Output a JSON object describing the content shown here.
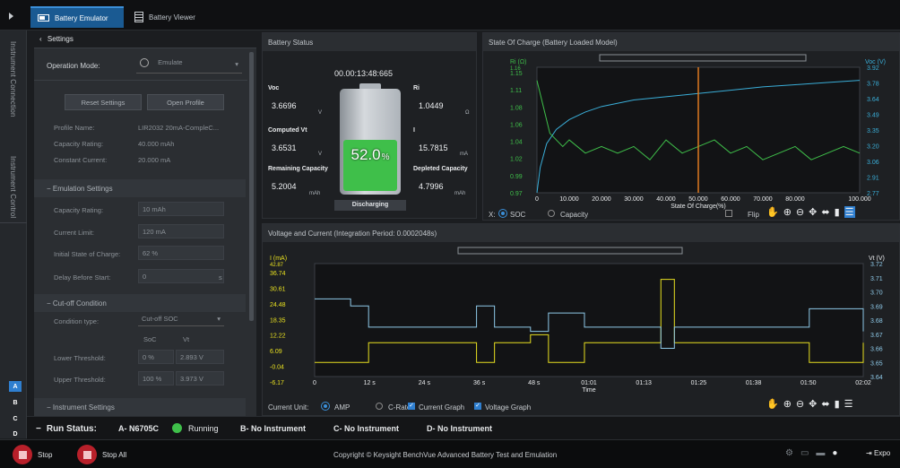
{
  "tabs": [
    {
      "label": "Battery Emulator"
    },
    {
      "label": "Battery Viewer"
    }
  ],
  "side": {
    "instrument_connection": "Instrument Connection",
    "instrument_control": "Instrument Control",
    "letters": [
      "A",
      "B",
      "C",
      "D"
    ]
  },
  "settings": {
    "title": "Settings",
    "operation_mode_label": "Operation Mode:",
    "operation_mode_value": "Emulate",
    "reset_button": "Reset Settings",
    "open_profile_button": "Open Profile",
    "profile_name_label": "Profile Name:",
    "profile_name_value": "LIR2032 20mA-CompleC...",
    "capacity_rating_label": "Capacity Rating:",
    "capacity_rating_value": "40.000 mAh",
    "constant_current_label": "Constant Current:",
    "constant_current_value": "20.000 mA",
    "emulation_settings": "Emulation Settings",
    "em_capacity_label": "Capacity Rating:",
    "em_capacity_value": "10 mAh",
    "current_limit_label": "Current Limit:",
    "current_limit_value": "120 mA",
    "initial_soc_label": "Initial State of Charge:",
    "initial_soc_value": "62 %",
    "delay_label": "Delay Before Start:",
    "delay_value": "0",
    "delay_unit": "s",
    "cutoff_title": "Cut-off Condition",
    "condition_type_label": "Condition type:",
    "condition_type_value": "Cut-off SOC",
    "col_soc": "SoC",
    "col_vt": "Vt",
    "lower_label": "Lower Threshold:",
    "lower_soc": "0 %",
    "lower_vt": "2.893 V",
    "upper_label": "Upper Threshold:",
    "upper_soc": "100 %",
    "upper_vt": "3.973 V",
    "instrument_settings": "Instrument Settings"
  },
  "battery": {
    "title": "Battery Status",
    "time": "00.00:13:48:665",
    "voc_label": "Voc",
    "voc_value": "3.6696",
    "voc_unit": "V",
    "ri_label": "Ri",
    "ri_value": "1.0449",
    "ri_unit": "Ω",
    "vt_label": "Computed Vt",
    "vt_value": "3.6531",
    "vt_unit": "V",
    "i_label": "I",
    "i_value": "15.7815",
    "i_unit": "mA",
    "rem_label": "Remaining Capacity",
    "rem_value": "5.2004",
    "rem_unit": "mAh",
    "dep_label": "Depleted Capacity",
    "dep_value": "4.7996",
    "dep_unit": "mAh",
    "percent": "52.0",
    "percent_unit": "%",
    "soc_fraction": 0.52,
    "state": "Discharging",
    "fill_color": "#3fbf4a"
  },
  "soc_chart": {
    "title": "State Of Charge (Battery Loaded Model)",
    "x_label": "State Of Charge(%)",
    "x_option_label": "X:",
    "opt_soc": "SOC",
    "opt_capacity": "Capacity",
    "flip_label": "Flip",
    "cursor_x": "50.000",
    "chart_data": {
      "type": "line",
      "xlabel": "State Of Charge(%)",
      "x_ticks": [
        "0",
        "10.000",
        "20.000",
        "30.000",
        "40.000",
        "50.000",
        "60.000",
        "70.000",
        "80.000",
        "100.000"
      ],
      "ri_axis": {
        "label": "Ri (Ω)",
        "top": "1.16",
        "ticks": [
          "1.15",
          "1.11",
          "1.08",
          "1.06",
          "1.04",
          "1.02",
          "0.99",
          "0.97"
        ]
      },
      "voc_axis": {
        "label": "Voc (V)",
        "ticks": [
          "3.92",
          "3.78",
          "3.64",
          "3.49",
          "3.35",
          "3.20",
          "3.06",
          "2.91",
          "2.77"
        ]
      },
      "series": [
        {
          "name": "Voc",
          "color": "#3aaed8",
          "x": [
            0,
            1,
            3,
            6,
            10,
            15,
            20,
            30,
            40,
            50,
            60,
            70,
            80,
            90,
            100
          ],
          "y": [
            2.77,
            3.0,
            3.22,
            3.35,
            3.44,
            3.51,
            3.56,
            3.62,
            3.65,
            3.68,
            3.71,
            3.74,
            3.76,
            3.78,
            3.8
          ]
        },
        {
          "name": "Ri",
          "color": "#3fbf4a",
          "x": [
            0,
            2,
            4,
            6,
            8,
            10,
            15,
            20,
            25,
            30,
            35,
            40,
            45,
            50,
            55,
            60,
            65,
            70,
            75,
            80,
            85,
            90,
            95,
            100
          ],
          "y": [
            1.14,
            1.1,
            1.06,
            1.05,
            1.04,
            1.05,
            1.03,
            1.04,
            1.03,
            1.04,
            1.02,
            1.05,
            1.03,
            1.04,
            1.05,
            1.03,
            1.04,
            1.02,
            1.03,
            1.04,
            1.02,
            1.03,
            1.04,
            1.03
          ]
        }
      ]
    }
  },
  "vi_chart": {
    "title": "Voltage and Current (Integration Period: 0.0002048s)",
    "x_label": "Time",
    "current_unit_label": "Current Unit:",
    "opt_amp": "AMP",
    "opt_crate": "C-Rate",
    "chk_current": "Current Graph",
    "chk_voltage": "Voltage Graph",
    "chart_data": {
      "type": "line",
      "xlabel": "Time",
      "x_ticks": [
        "0",
        "12 s",
        "24 s",
        "36 s",
        "48 s",
        "01:01",
        "01:13",
        "01:25",
        "01:38",
        "01:50",
        "02:02"
      ],
      "i_axis": {
        "label": "I (mA)",
        "top": "42.87",
        "ticks": [
          "36.74",
          "30.61",
          "24.48",
          "18.35",
          "12.22",
          "6.09",
          "-0.04",
          "-6.17"
        ]
      },
      "vt_axis": {
        "label": "Vt (V)",
        "ticks": [
          "3.72",
          "3.71",
          "3.70",
          "3.69",
          "3.68",
          "3.67",
          "3.66",
          "3.65",
          "3.64"
        ]
      },
      "series": [
        {
          "name": "Current",
          "color": "#e8e020",
          "x": [
            0,
            10,
            12,
            20,
            30,
            36,
            40,
            48,
            52,
            60,
            70,
            77,
            80,
            90,
            100,
            110,
            122
          ],
          "y": [
            -0.04,
            -0.04,
            8.5,
            8.5,
            8.5,
            -0.04,
            8.5,
            12,
            -0.04,
            8.5,
            8.5,
            36,
            8.5,
            8.5,
            8.5,
            -0.04,
            8.5
          ]
        },
        {
          "name": "Voltage",
          "color": "#8ec9e8",
          "x": [
            0,
            8,
            12,
            20,
            30,
            36,
            40,
            48,
            52,
            60,
            70,
            77,
            80,
            90,
            100,
            110,
            122
          ],
          "y": [
            3.695,
            3.69,
            3.675,
            3.675,
            3.675,
            3.69,
            3.675,
            3.672,
            3.685,
            3.675,
            3.675,
            3.66,
            3.675,
            3.675,
            3.675,
            3.688,
            3.672
          ]
        }
      ]
    }
  },
  "run_status": {
    "label": "Run Status:",
    "a": "A- N6705C",
    "a_state": "Running",
    "b": "B- No Instrument",
    "c": "C- No Instrument",
    "d": "D- No Instrument"
  },
  "bottom": {
    "stop": "Stop",
    "stop_all": "Stop All",
    "copyright": "Copyright © Keysight BenchVue Advanced Battery Test and Emulation",
    "export": "Expo"
  }
}
